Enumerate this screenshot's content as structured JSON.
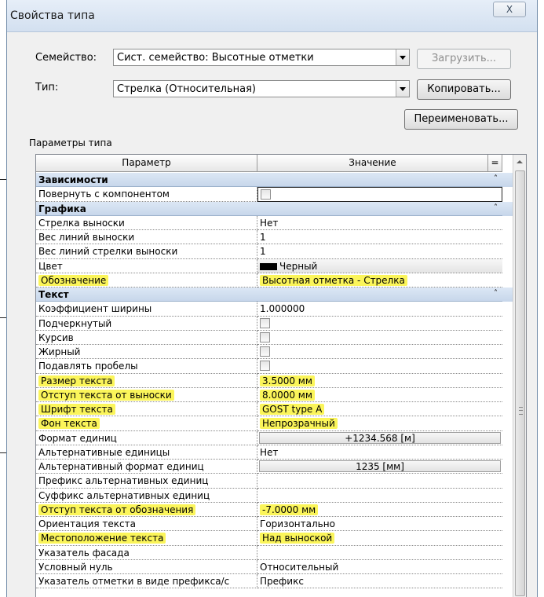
{
  "window": {
    "title": "Свойства типа",
    "close_label": "X"
  },
  "family": {
    "label": "Семейство:",
    "value": "Сист. семейство: Высотные отметки"
  },
  "type": {
    "label": "Тип:",
    "value": "Стрелка (Относительная)"
  },
  "buttons": {
    "load": "Загрузить...",
    "copy": "Копировать...",
    "rename": "Переименовать..."
  },
  "params_label": "Параметры типа",
  "columns": {
    "param": "Параметр",
    "value": "Значение",
    "eq": "="
  },
  "rows": [
    {
      "kind": "group",
      "param": "Зависимости"
    },
    {
      "kind": "check",
      "param": "Повернуть с компонентом",
      "boxed": true
    },
    {
      "kind": "group",
      "param": "Графика"
    },
    {
      "kind": "text",
      "param": "Стрелка выноски",
      "value": "Нет"
    },
    {
      "kind": "text",
      "param": "Вес линий выноски",
      "value": "1"
    },
    {
      "kind": "text",
      "param": "Вес линий стрелки выноски",
      "value": "1"
    },
    {
      "kind": "color",
      "param": "Цвет",
      "value": "Черный"
    },
    {
      "kind": "text",
      "param": "Обозначение",
      "value": "Высотная отметка - Стрелка",
      "highlight": true
    },
    {
      "kind": "group",
      "param": "Текст"
    },
    {
      "kind": "text",
      "param": "Коэффициент ширины",
      "value": "1.000000"
    },
    {
      "kind": "check",
      "param": "Подчеркнутый"
    },
    {
      "kind": "check",
      "param": "Курсив"
    },
    {
      "kind": "check",
      "param": "Жирный"
    },
    {
      "kind": "check",
      "param": "Подавлять пробелы"
    },
    {
      "kind": "text",
      "param": "Размер текста",
      "value": "3.5000 мм",
      "highlight": true
    },
    {
      "kind": "text",
      "param": "Отступ текста от выноски",
      "value": "8.0000 мм",
      "highlight": true
    },
    {
      "kind": "text",
      "param": "Шрифт текста",
      "value": "GOST type A",
      "highlight": true
    },
    {
      "kind": "text",
      "param": "Фон текста",
      "value": "Непрозрачный",
      "highlight": true
    },
    {
      "kind": "button",
      "param": "Формат единиц",
      "value": "+1234.568 [м]"
    },
    {
      "kind": "text",
      "param": "Альтернативные единицы",
      "value": "Нет"
    },
    {
      "kind": "button",
      "param": "Альтернативный формат единиц",
      "value": "1235 [мм]"
    },
    {
      "kind": "text",
      "param": "Префикс альтернативных единиц",
      "value": ""
    },
    {
      "kind": "text",
      "param": "Суффикс альтернативных единиц",
      "value": ""
    },
    {
      "kind": "text",
      "param": "Отступ текста от обозначения",
      "value": "-7.0000 мм",
      "highlight": true
    },
    {
      "kind": "text",
      "param": "Ориентация текста",
      "value": "Горизонтально"
    },
    {
      "kind": "text",
      "param": "Местоположение текста",
      "value": "Над выноской",
      "highlight": true
    },
    {
      "kind": "text",
      "param": "Указатель фасада",
      "value": ""
    },
    {
      "kind": "text",
      "param": "Условный нуль",
      "value": "Относительный"
    },
    {
      "kind": "text",
      "param": "Указатель отметки в виде префикса/с",
      "value": "Префикс"
    }
  ]
}
